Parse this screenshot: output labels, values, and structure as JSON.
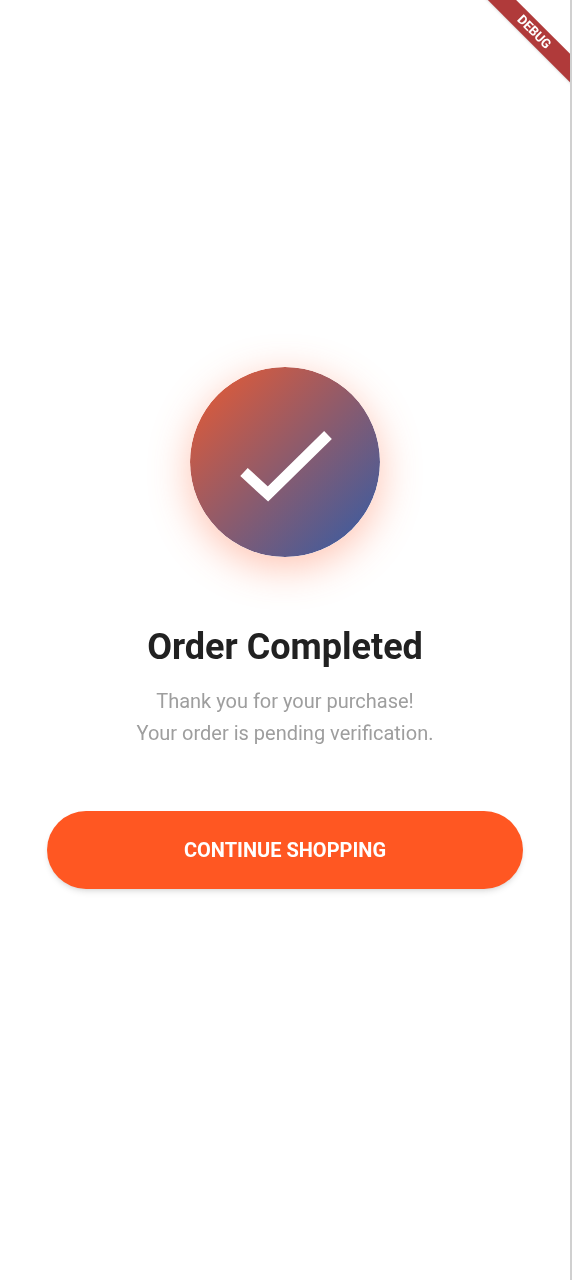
{
  "debug_banner": {
    "label": "DEBUG"
  },
  "title": "Order Completed",
  "message": [
    "Thank you for your purchase!",
    "Your order is pending verification."
  ],
  "button": {
    "label": "CONTINUE SHOPPING"
  }
}
